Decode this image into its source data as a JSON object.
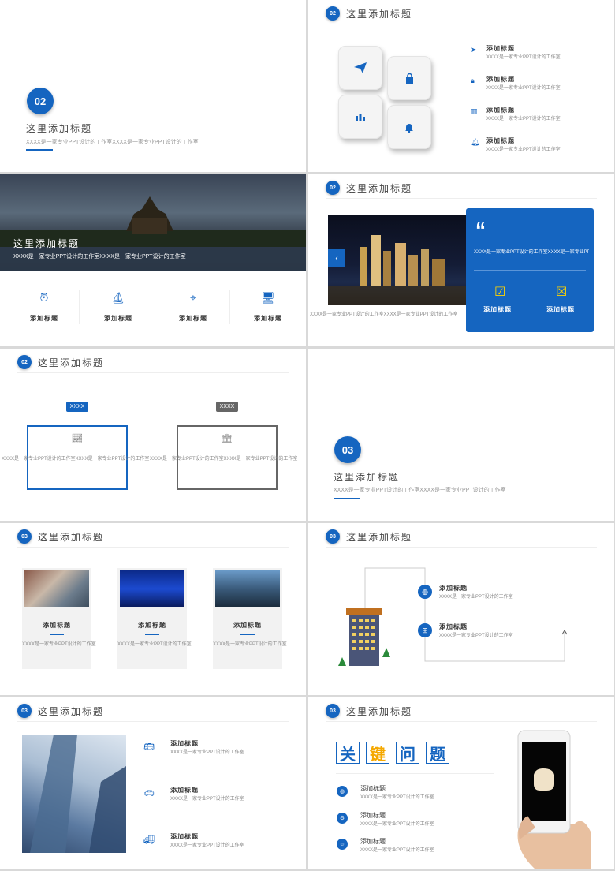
{
  "s1": {
    "num": "02",
    "title": "这里添加标题",
    "sub": "XXXX是一家专业PPT设计的工作室XXXX是一家专业PPT设计的工作室"
  },
  "s2": {
    "num": "02",
    "title": "这里添加标题",
    "items": [
      {
        "label": "添加标题",
        "desc": "XXXX是一家专业PPT设计的工作室",
        "icon": "paper-plane"
      },
      {
        "label": "添加标题",
        "desc": "XXXX是一家专业PPT设计的工作室",
        "icon": "lock"
      },
      {
        "label": "添加标题",
        "desc": "XXXX是一家专业PPT设计的工作室",
        "icon": "bar-chart"
      },
      {
        "label": "添加标题",
        "desc": "XXXX是一家专业PPT设计的工作室",
        "icon": "bell"
      }
    ]
  },
  "s3": {
    "title": "这里添加标题",
    "sub": "XXXX是一家专业PPT设计的工作室XXXX是一家专业PPT设计的工作室",
    "items": [
      "添加标题",
      "添加标题",
      "添加标题",
      "添加标题"
    ]
  },
  "s4": {
    "num": "02",
    "title": "这里添加标题",
    "quote": "XXXX是一家专业PPT设计的工作室XXXX是一家专业PPT设计的工作室",
    "caption": "XXXX是一家专业PPT设计的工作室XXXX是一家专业PPT设计的工作室",
    "opt1": "添加标题",
    "opt2": "添加标题"
  },
  "s5": {
    "num": "02",
    "title": "这里添加标题",
    "tag1": "XXXX",
    "tag2": "XXXX",
    "text1": "XXXX是一家专业PPT设计的工作室XXXX是一家专业PPT设计的工作室",
    "text2": "XXXX是一家专业PPT设计的工作室XXXX是一家专业PPT设计的工作室"
  },
  "s6": {
    "num": "03",
    "title": "这里添加标题",
    "sub": "XXXX是一家专业PPT设计的工作室XXXX是一家专业PPT设计的工作室"
  },
  "s7": {
    "num": "03",
    "title": "这里添加标题",
    "cards": [
      {
        "label": "添加标题",
        "desc": "XXXX是一家专业PPT设计的工作室"
      },
      {
        "label": "添加标题",
        "desc": "XXXX是一家专业PPT设计的工作室"
      },
      {
        "label": "添加标题",
        "desc": "XXXX是一家专业PPT设计的工作室"
      }
    ]
  },
  "s8": {
    "num": "03",
    "title": "这里添加标题",
    "items": [
      {
        "label": "添加标题",
        "desc": "XXXX是一家专业PPT设计的工作室"
      },
      {
        "label": "添加标题",
        "desc": "XXXX是一家专业PPT设计的工作室"
      }
    ]
  },
  "s9": {
    "num": "03",
    "title": "这里添加标题",
    "items": [
      {
        "label": "添加标题",
        "desc": "XXXX是一家专业PPT设计的工作室",
        "icon": "bus"
      },
      {
        "label": "添加标题",
        "desc": "XXXX是一家专业PPT设计的工作室",
        "icon": "car"
      },
      {
        "label": "添加标题",
        "desc": "XXXX是一家专业PPT设计的工作室",
        "icon": "truck"
      }
    ]
  },
  "s10": {
    "num": "03",
    "title": "这里添加标题",
    "keywords": [
      "关",
      "键",
      "问",
      "题"
    ],
    "items": [
      {
        "label": "添加标题",
        "desc": "XXXX是一家专业PPT设计的工作室"
      },
      {
        "label": "添加标题",
        "desc": "XXXX是一家专业PPT设计的工作室"
      },
      {
        "label": "添加标题",
        "desc": "XXXX是一家专业PPT设计的工作室"
      }
    ]
  },
  "colors": {
    "accent": "#1565c0",
    "gray": "#666666",
    "keyword_yellow": "#f5a800"
  }
}
